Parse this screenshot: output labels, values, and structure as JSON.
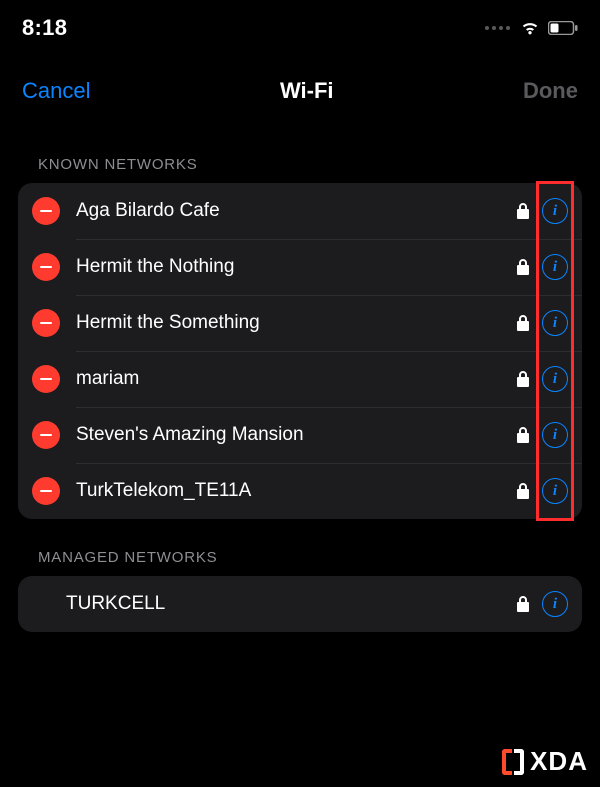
{
  "status": {
    "time": "8:18"
  },
  "nav": {
    "cancel": "Cancel",
    "title": "Wi-Fi",
    "done": "Done"
  },
  "sections": {
    "known": {
      "header": "Known Networks",
      "items": [
        {
          "name": "Aga Bilardo Cafe"
        },
        {
          "name": "Hermit the Nothing"
        },
        {
          "name": "Hermit the Something"
        },
        {
          "name": "mariam"
        },
        {
          "name": "Steven's Amazing Mansion"
        },
        {
          "name": "TurkTelekom_TE11A"
        }
      ]
    },
    "managed": {
      "header": "Managed Networks",
      "items": [
        {
          "name": "TURKCELL"
        }
      ]
    }
  },
  "watermark": {
    "text": "XDA"
  }
}
